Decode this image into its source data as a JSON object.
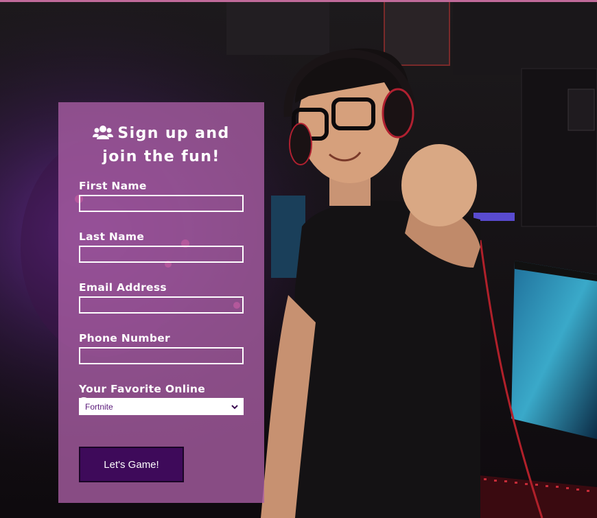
{
  "form": {
    "title_line1": "Sign up and",
    "title_line2": "join the fun!",
    "first_name_label": "First Name",
    "last_name_label": "Last Name",
    "email_label": "Email Address",
    "phone_label": "Phone Number",
    "game_label": "Your Favorite Online Game",
    "game_selected": "Fortnite",
    "submit_label": "Let's Game!"
  },
  "colors": {
    "panel": "#aa5fa5",
    "button": "#3e0a5a",
    "accent_line": "#c06a9a"
  }
}
